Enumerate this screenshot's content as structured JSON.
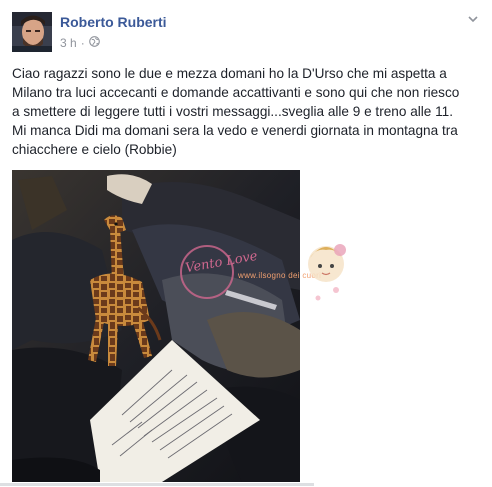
{
  "post": {
    "author": "Roberto Ruberti",
    "time": "3 h",
    "separator": "·",
    "text": "Ciao ragazzi sono le due e mezza domani ho la D'Urso che mi aspetta a\nMilano tra luci accecanti e domande accattivanti e sono qui che non riesco\na smettere di leggere tutti i vostri messaggi...sveglia alle 9 e treno alle 11.\nMi manca Didi ma domani sera la vedo e venerdi giornata in montagna tra\nchiacchere e cielo (Robbie)"
  },
  "watermark": {
    "circle_text": "Vento Love",
    "url": "www.ilsogno dei cuori"
  },
  "icons": {
    "audience": "globe-icon",
    "menu": "chevron-down-icon"
  },
  "colors": {
    "author": "#3b5998",
    "meta": "#90949c",
    "text": "#1d2129"
  }
}
